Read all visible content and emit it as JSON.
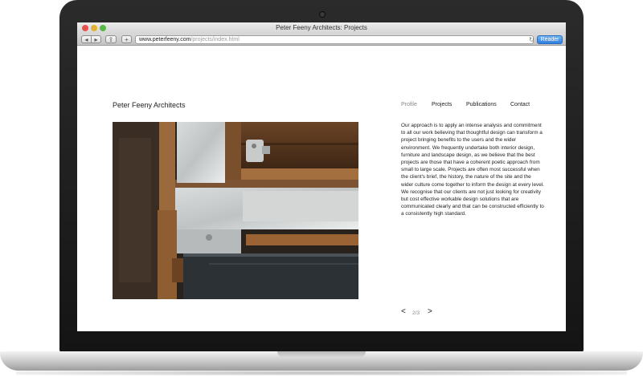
{
  "window": {
    "title": "Peter Feeny Architects: Projects"
  },
  "toolbar": {
    "back_icon": "◂",
    "forward_icon": "▸",
    "share_icon": "⇪",
    "add_icon": "+",
    "reload_icon": "↻",
    "reader_label": "Reader"
  },
  "url": {
    "host": "www.peterfeeny.com",
    "path": "/projects/index.html"
  },
  "site": {
    "title": "Peter Feeny Architects"
  },
  "nav": {
    "items": [
      "Profile",
      "Projects",
      "Publications",
      "Contact"
    ]
  },
  "content": {
    "description": "Our approach is to apply an intense analysis and commitment to all our work believing that thoughtful design can transform a project bringing benefits to the users and the wider environment. We frequently undertake both interior design, furniture and landscape design, as we believe that the best projects are those that have a coherent poetic approach from small to large scale. Projects are often most successful when the client's brief, the history, the nature of the site and the wider culture come together to inform the design at every level. We recognise that our clients are not just looking for creativity but cost effective workable design solutions that are communicated clearly and that can be constructed efficiently to a consistently high standard."
  },
  "pager": {
    "prev": "<",
    "count": "2/3",
    "next": ">"
  },
  "colors": {
    "reader_button": "#2f7fde",
    "nav_active": "#888888",
    "close_button": "#e8524e",
    "minimize_button": "#e5b135",
    "zoom_button": "#58b846"
  }
}
